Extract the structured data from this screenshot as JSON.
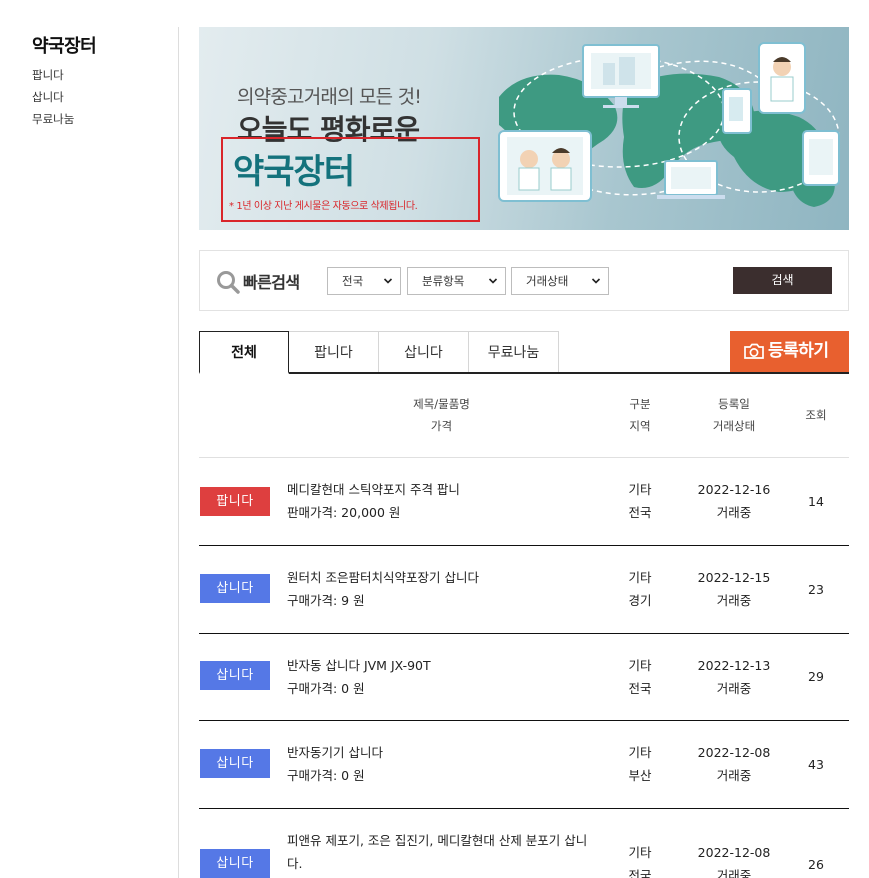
{
  "sidebar": {
    "title": "약국장터",
    "items": [
      {
        "label": "팝니다"
      },
      {
        "label": "삽니다"
      },
      {
        "label": "무료나눔"
      }
    ]
  },
  "banner": {
    "line1": "의약중고거래의 모든 것!",
    "line2": "오늘도 평화로운",
    "big": "약국장터",
    "notice": "* 1년 이상 지난 게시물은 자동으로 삭제됩니다."
  },
  "search": {
    "label": "빠른검색",
    "region": "전국",
    "category": "분류항목",
    "status": "거래상태",
    "button": "검색"
  },
  "tabs": [
    {
      "label": "전체",
      "active": true
    },
    {
      "label": "팝니다"
    },
    {
      "label": "삽니다"
    },
    {
      "label": "무료나눔"
    }
  ],
  "register_button": "등록하기",
  "table_header": {
    "title": "제목/물품명",
    "price": "가격",
    "category": "구분",
    "region": "지역",
    "date": "등록일",
    "status": "거래상태",
    "views": "조회"
  },
  "rows": [
    {
      "badge": "팝니다",
      "type": "sell",
      "title": "메디칼현대 스틱약포지 주격 팝니",
      "price": "판매가격: 20,000 원",
      "category": "기타",
      "region": "전국",
      "date": "2022-12-16",
      "status": "거래중",
      "views": "14"
    },
    {
      "badge": "삽니다",
      "type": "buy",
      "title": "원터치 조은팜터치식약포장기 삽니다",
      "price": "구매가격: 9 원",
      "category": "기타",
      "region": "경기",
      "date": "2022-12-15",
      "status": "거래중",
      "views": "23"
    },
    {
      "badge": "삽니다",
      "type": "buy",
      "title": "반자동 삽니다 JVM JX-90T",
      "price": "구매가격: 0 원",
      "category": "기타",
      "region": "전국",
      "date": "2022-12-13",
      "status": "거래중",
      "views": "29"
    },
    {
      "badge": "삽니다",
      "type": "buy",
      "title": "반자동기기 삽니다",
      "price": "구매가격: 0 원",
      "category": "기타",
      "region": "부산",
      "date": "2022-12-08",
      "status": "거래중",
      "views": "43"
    },
    {
      "badge": "삽니다",
      "type": "buy",
      "title": "피앤유 제포기, 조은 집진기, 메디칼현대 산제 분포기 삽니다.",
      "price": "",
      "category": "기타",
      "region": "전국",
      "date": "2022-12-08",
      "status": "거래중",
      "views": "26"
    }
  ],
  "colors": {
    "sell_badge": "#de3f3f",
    "buy_badge": "#5578e6",
    "register_button": "#e8602f",
    "search_button": "#3b2e2e",
    "banner_title": "#14727c",
    "notice_red": "#d9252a"
  },
  "icons": {
    "search": "magnifier-icon",
    "chevron": "chevron-down-icon",
    "camera": "camera-icon"
  }
}
